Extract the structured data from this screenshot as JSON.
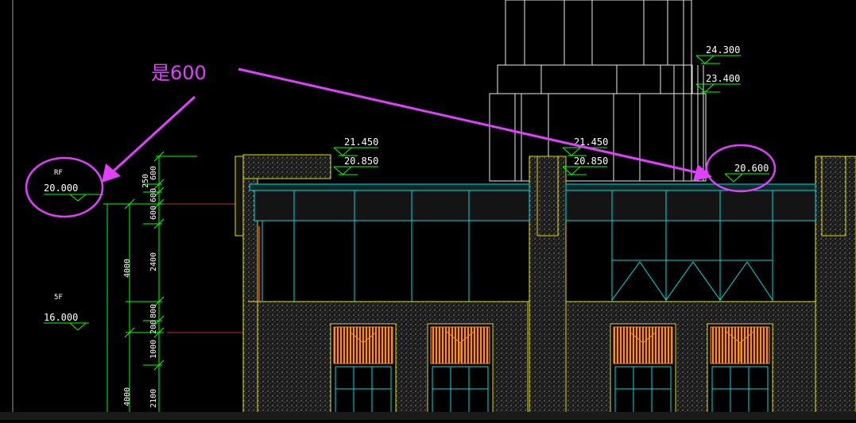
{
  "annotation": {
    "text": "是600",
    "color": "#e040ff"
  },
  "left_levels": {
    "rf_name": "RF",
    "rf_value": "20.000",
    "f5_name": "5F",
    "f5_value": "16.000"
  },
  "dims": {
    "d600a": "600",
    "d250": "250",
    "d600b": "600",
    "d600c": "600",
    "d4000a": "4000",
    "d2400": "2400",
    "d200": "200",
    "d800": "800",
    "d1000": "1000",
    "d4000b": "4000",
    "d2100": "2100"
  },
  "elevations": {
    "e24300": "24.300",
    "e23400": "23.400",
    "e21450a": "21.450",
    "e20850a": "20.850",
    "e21450b": "21.450",
    "e20850b": "20.850",
    "e20600": "20.600"
  },
  "colors": {
    "background": "#000000",
    "dimension_green": "#00ff00",
    "outline_yellow": "#e0e000",
    "glass_cyan": "#00d8d8",
    "tower_white": "#e8e8e8",
    "level_red": "#c03020",
    "orange_panel": "#ff8c20",
    "annotation_magenta": "#e040ff"
  }
}
